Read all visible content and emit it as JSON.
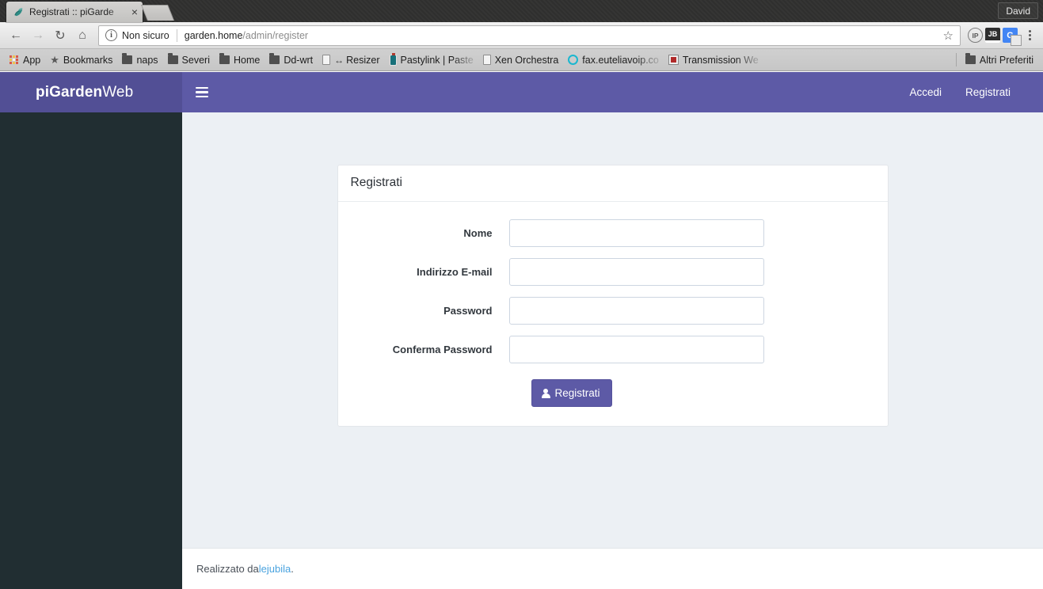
{
  "browser": {
    "tab": {
      "title": "Registrati :: piGarde",
      "favicon": "plant-icon",
      "close_label": "×"
    },
    "new_tab_label": "+",
    "profile_name": "David",
    "nav": {
      "back": "←",
      "forward": "→",
      "reload": "↻",
      "home": "⌂"
    },
    "omnibox": {
      "info_icon": "ⓘ",
      "security_label": "Non sicuro",
      "url_host": "garden.home",
      "url_path": "/admin/register",
      "star_icon": "☆"
    },
    "extensions": [
      {
        "name": "ip-extension",
        "label": "IP"
      },
      {
        "name": "jb-extension",
        "label": "JB"
      },
      {
        "name": "google-translate-extension",
        "label": "G"
      }
    ],
    "menu_icon": "kebab-menu-icon",
    "bookmarks": [
      {
        "label": "App",
        "icon": "apps-grid-icon"
      },
      {
        "label": "Bookmarks",
        "icon": "star-icon"
      },
      {
        "label": "naps",
        "icon": "folder-icon"
      },
      {
        "label": "Severi",
        "icon": "folder-icon"
      },
      {
        "label": "Home",
        "icon": "folder-icon"
      },
      {
        "label": "Dd-wrt",
        "icon": "folder-icon"
      },
      {
        "label": "Resizer",
        "icon": "document-icon",
        "prefix": "↔"
      },
      {
        "label": "Pastylink | Paste",
        "icon": "bottle-icon",
        "truncated": true
      },
      {
        "label": "Xen Orchestra",
        "icon": "document-icon"
      },
      {
        "label": "fax.euteliavoip.co",
        "icon": "circle-icon",
        "truncated": true
      },
      {
        "label": "Transmission We",
        "icon": "transmission-icon",
        "truncated": true
      }
    ],
    "other_bookmarks": {
      "label": "Altri Preferiti",
      "icon": "folder-icon"
    }
  },
  "site": {
    "navbar": {
      "brand_bold": "piGarden",
      "brand_light": "Web",
      "toggle_icon": "hamburger-icon",
      "links": [
        {
          "label": "Accedi",
          "name": "nav-link-login"
        },
        {
          "label": "Registrati",
          "name": "nav-link-register"
        }
      ]
    },
    "card": {
      "title": "Registrati",
      "fields": [
        {
          "label": "Nome",
          "value": "",
          "placeholder": "",
          "type": "text",
          "name": "name-field"
        },
        {
          "label": "Indirizzo E-mail",
          "value": "",
          "placeholder": "",
          "type": "text",
          "name": "email-field"
        },
        {
          "label": "Password",
          "value": "",
          "placeholder": "",
          "type": "password",
          "name": "password-field"
        },
        {
          "label": "Conferma Password",
          "value": "",
          "placeholder": "",
          "type": "password",
          "name": "confirm-password-field"
        }
      ],
      "submit": {
        "label": "Registrati",
        "icon": "user-icon"
      }
    },
    "footer": {
      "text_before": "Realizzato da ",
      "link": "lejubila",
      "text_after": "."
    },
    "colors": {
      "navbar": "#5d5aa6",
      "navbar_brand": "#524f95",
      "sidebar": "#212e32",
      "content_bg": "#ecf0f4",
      "button": "#5d5aa6",
      "link": "#4aa3df"
    }
  }
}
